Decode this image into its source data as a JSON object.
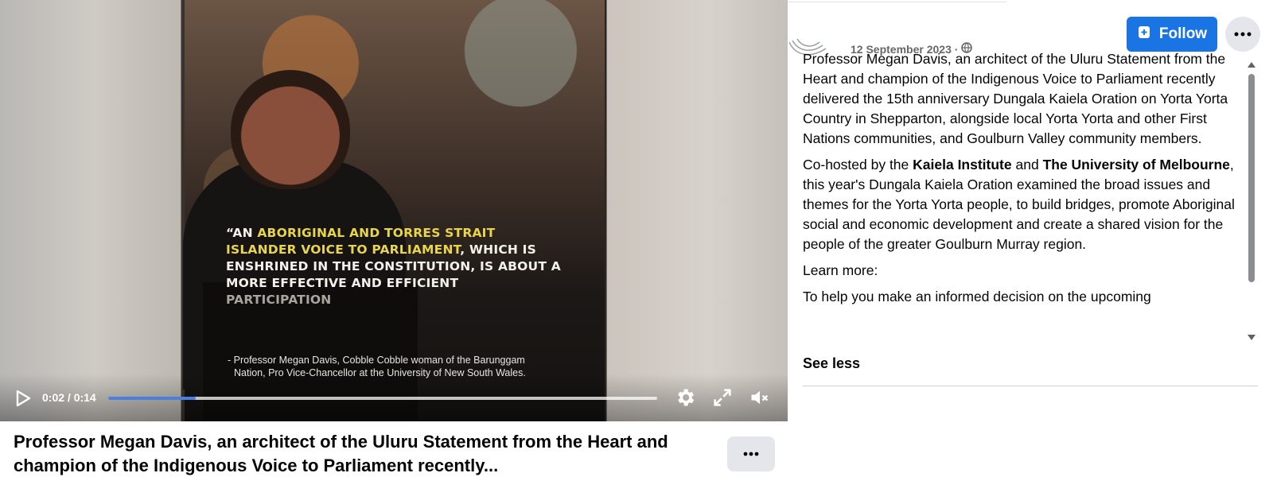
{
  "video": {
    "quote": {
      "open": "“AN ",
      "hl1": "ABORIGINAL AND TORRES STRAIT ISLANDER VOICE TO PARLIAMENT",
      "mid": ", WHICH IS ENSHRINED IN THE CONSTITUTION, IS ABOUT A MORE EFFECTIVE AND ",
      "hl2": "EFFICIENT",
      "space": " ",
      "end": "PARTICIPATION"
    },
    "caption_line1": "- Professor Megan Davis, Cobble Cobble woman of the Barunggam",
    "caption_line2": "Nation, Pro Vice-Chancellor at the University of New South Wales.",
    "controls": {
      "time": "0:02 / 0:14",
      "progress": 0.16
    }
  },
  "title": "Professor Megan Davis, an architect of the Uluru Statement from the Heart and champion of the Indigenous Voice to Parliament recently...",
  "panel": {
    "follow_label": "Follow",
    "date": "12 September 2023 ·",
    "post": {
      "p1": "Professor Megan Davis, an architect of the Uluru Statement from the Heart and champion of the Indigenous Voice to Parliament recently delivered the 15th anniversary Dungala Kaiela Oration on Yorta Yorta Country in Shepparton, alongside local Yorta Yorta and other First Nations communities, and Goulburn Valley community members.",
      "p2_a": "Co-hosted by the ",
      "p2_b1": "Kaiela Institute",
      "p2_c": " and ",
      "p2_b2": "The University of Melbourne",
      "p2_d": ", this year's Dungala Kaiela Oration examined the broad issues and themes for the Yorta Yorta people, to build bridges, promote Aboriginal social and economic development and create a shared vision for the people of the greater Goulburn Murray region.",
      "learn_more": "Learn more:",
      "p4": "To help you make an informed decision on the upcoming"
    },
    "see_less": "See less"
  }
}
